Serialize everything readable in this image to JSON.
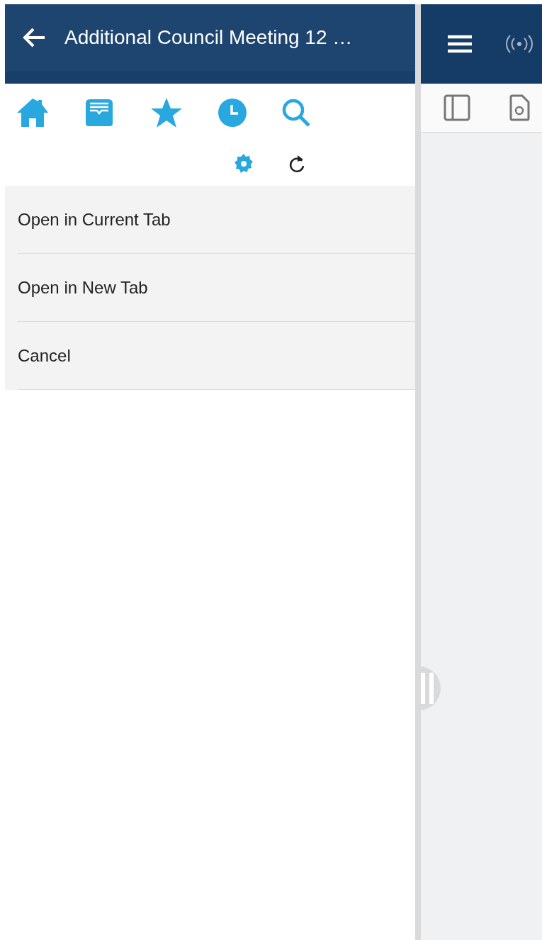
{
  "left_panel": {
    "header": {
      "title": "Additional Council Meeting 12 …"
    },
    "menu": [
      {
        "label": "Open in Current Tab"
      },
      {
        "label": "Open in New Tab"
      },
      {
        "label": "Cancel"
      }
    ]
  }
}
